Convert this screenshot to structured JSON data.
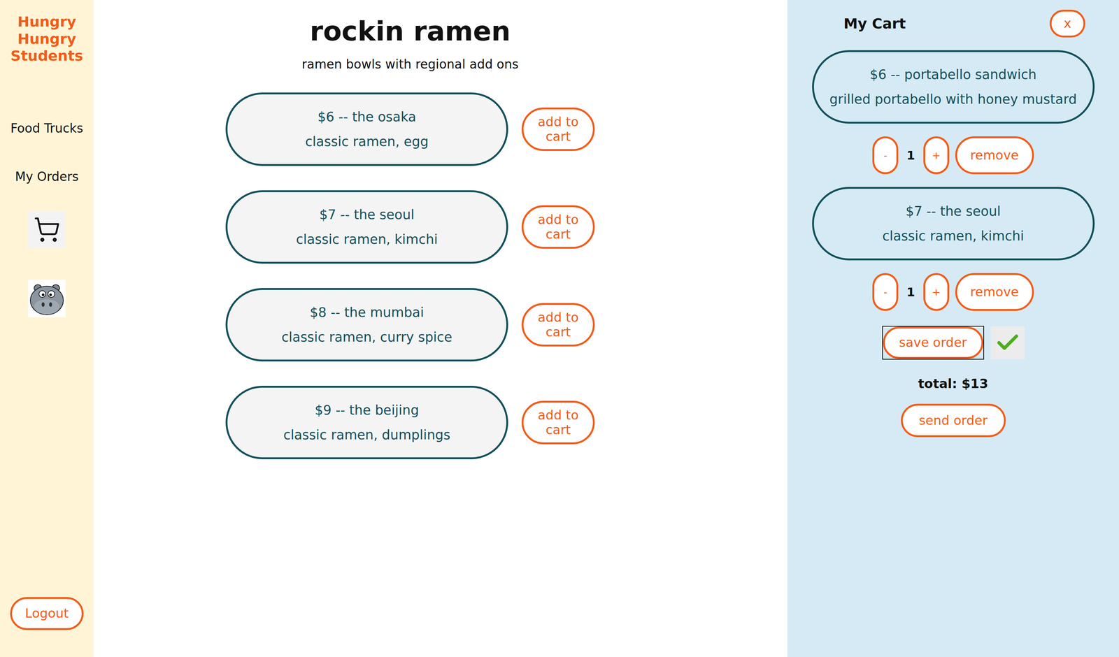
{
  "app": {
    "title": "Hungry Hungry Students"
  },
  "sidebar": {
    "items": [
      {
        "label": "Food Trucks"
      },
      {
        "label": "My Orders"
      }
    ],
    "logout": "Logout"
  },
  "truck": {
    "name": "rockin ramen",
    "description": "ramen bowls with regional add ons"
  },
  "menu": [
    {
      "price": "$6 -- the osaka",
      "description": "classic ramen, egg",
      "button": "add to cart"
    },
    {
      "price": "$7 -- the seoul",
      "description": "classic ramen, kimchi",
      "button": "add to cart"
    },
    {
      "price": "$8 -- the mumbai",
      "description": "classic ramen, curry spice",
      "button": "add to cart"
    },
    {
      "price": "$9 -- the beijing",
      "description": "classic ramen, dumplings",
      "button": "add to cart"
    }
  ],
  "cart": {
    "title": "My Cart",
    "close": "x",
    "items": [
      {
        "price": "$6 -- portabello sandwich",
        "description": "grilled portabello with honey mustard",
        "quantity": "1",
        "decrement": "-",
        "increment": "+",
        "remove": "remove"
      },
      {
        "price": "$7 -- the seoul",
        "description": "classic ramen, kimchi",
        "quantity": "1",
        "decrement": "-",
        "increment": "+",
        "remove": "remove"
      }
    ],
    "save": "save order",
    "saved": true,
    "total": "total: $13",
    "send": "send order"
  }
}
